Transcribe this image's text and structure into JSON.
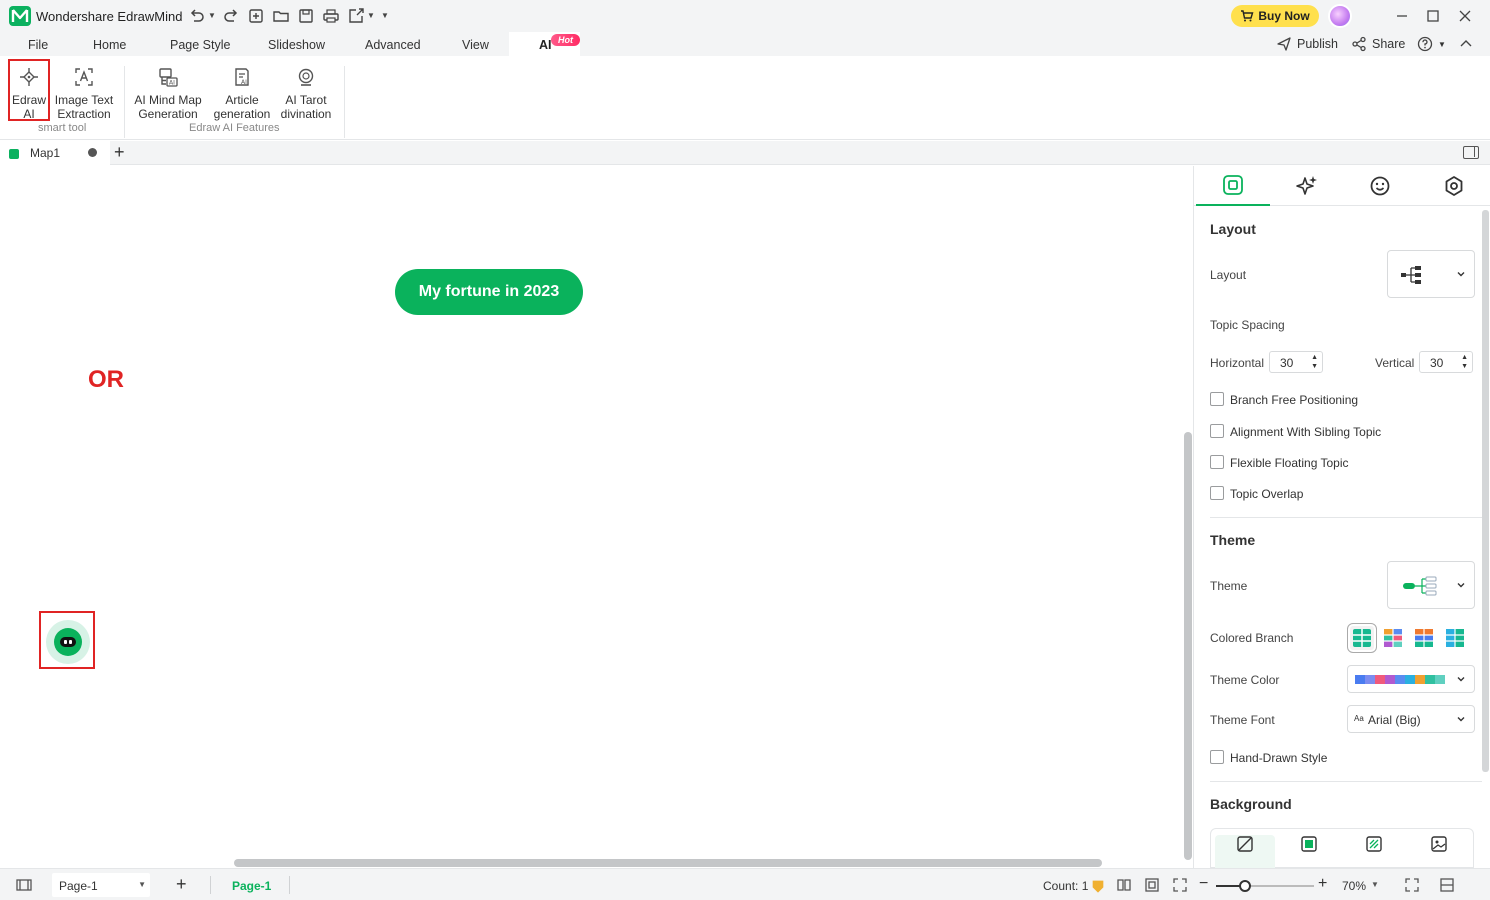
{
  "app": {
    "title": "Wondershare EdrawMind"
  },
  "header": {
    "buy_now": "Buy Now",
    "publish": "Publish",
    "share": "Share"
  },
  "menu": {
    "items": [
      "File",
      "Home",
      "Page Style",
      "Slideshow",
      "Advanced",
      "View"
    ],
    "active": "AI",
    "hot_badge": "Hot"
  },
  "ribbon": {
    "smart_tool": {
      "group_label": "smart tool",
      "buttons": [
        {
          "line1": "Edraw",
          "line2": "AI",
          "icon": "edraw-ai-icon"
        },
        {
          "line1": "Image Text",
          "line2": "Extraction",
          "icon": "image-text-icon"
        }
      ]
    },
    "ai_features": {
      "group_label": "Edraw AI Features",
      "buttons": [
        {
          "line1": "AI Mind Map",
          "line2": "Generation",
          "icon": "ai-mindmap-icon"
        },
        {
          "line1": "Article",
          "line2": "generation",
          "icon": "article-icon"
        },
        {
          "line1": "AI Tarot",
          "line2": "divination",
          "icon": "tarot-icon"
        }
      ]
    }
  },
  "doc_tabs": {
    "active": "Map1"
  },
  "canvas": {
    "central_topic": "My fortune in 2023",
    "annotation": "OR"
  },
  "panel": {
    "layout_section": {
      "title": "Layout",
      "layout_label": "Layout",
      "topic_spacing": "Topic Spacing",
      "horizontal_label": "Horizontal",
      "horizontal_value": "30",
      "vertical_label": "Vertical",
      "vertical_value": "30",
      "checkboxes": [
        "Branch Free Positioning",
        "Alignment With Sibling Topic",
        "Flexible Floating Topic",
        "Topic Overlap"
      ]
    },
    "theme_section": {
      "title": "Theme",
      "theme_label": "Theme",
      "colored_branch": "Colored Branch",
      "theme_color": "Theme Color",
      "theme_font": "Theme Font",
      "font_value": "Arial (Big)",
      "font_prefix": "Aa",
      "hand_drawn": "Hand-Drawn Style",
      "palette": [
        "#4a7cf0",
        "#7c8cf0",
        "#f05a7c",
        "#b05ad0",
        "#5a8cf0",
        "#2ab0e0",
        "#f0a030",
        "#30c0a0",
        "#60d0c0"
      ]
    },
    "background_section": {
      "title": "Background"
    }
  },
  "status": {
    "page_select": "Page-1",
    "page_tab": "Page-1",
    "count": "Count: 1",
    "zoom": "70%",
    "zoom_level_percent": 30
  },
  "colors": {
    "brand": "#0ab25c",
    "highlight": "#e02424",
    "buy": "#ffe04d"
  }
}
